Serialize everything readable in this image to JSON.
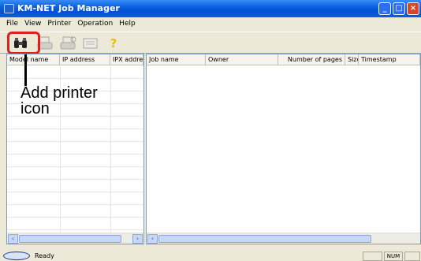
{
  "window": {
    "title": "KM-NET Job Manager"
  },
  "menu": [
    "File",
    "View",
    "Printer",
    "Operation",
    "Help"
  ],
  "toolbar": {
    "icons": [
      "binoculars-icon",
      "printer-icon",
      "printer-settings-icon",
      "properties-icon",
      "help-icon"
    ],
    "help_glyph": "?"
  },
  "left_pane": {
    "columns": [
      "Model name",
      "IP address",
      "IPX address"
    ]
  },
  "right_pane": {
    "columns": [
      "Job name",
      "Owner",
      "Number of pages",
      "Size",
      "Timestamp"
    ]
  },
  "status": {
    "text": "Ready",
    "num": "NUM",
    "logo": "KM-NET"
  },
  "annotation": {
    "line1": "Add printer",
    "line2": "icon"
  },
  "colors": {
    "highlight": "#e0201c",
    "titlebar": "#0a5fe0"
  }
}
